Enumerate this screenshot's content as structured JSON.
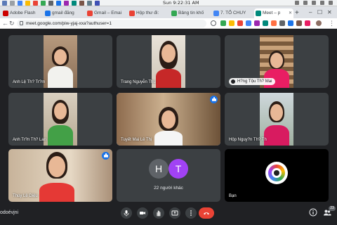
{
  "os": {
    "clock": "Sun 9:22:31 AM"
  },
  "browser": {
    "tabs": [
      {
        "label": "Adobe Flash",
        "color": "#cc0000"
      },
      {
        "label": "gmail đăng",
        "color": "#1a73e8"
      },
      {
        "label": "Gmail – Emai",
        "color": "#ea4335"
      },
      {
        "label": "Hộp thư đi:",
        "color": "#ea4335"
      },
      {
        "label": "Bảng tin khố",
        "color": "#34a853"
      },
      {
        "label": "7. TỔ CHUY",
        "color": "#4285f4"
      },
      {
        "label": "Meet – p",
        "color": "#00897b"
      }
    ],
    "url": "meet.google.com/piw-yjaj-xxa?authuser=1"
  },
  "meet": {
    "tiles": [
      {
        "name": "Anh Lệ Th? Tr?m"
      },
      {
        "name": "Trang Nguyễn Thu"
      },
      {
        "name": "H?ng Tộu Th? Mai"
      },
      {
        "name": "Anh Tr?n Th? Lan"
      },
      {
        "name": "Tuyết Mai Lê Thị"
      },
      {
        "name": "Hộp Nguy?n Th? Th"
      },
      {
        "name": "Thúy Lê Diệu"
      },
      {
        "name": "22 người khác",
        "avatars": [
          "H",
          "T"
        ]
      },
      {
        "name": "Bạn"
      }
    ],
    "meeting_code": "odoévjni",
    "participant_count": "23"
  },
  "colors": {
    "accent": "#8ab4f8",
    "end_call": "#ea4335",
    "avatar_h": "#5f6368",
    "avatar_t": "#a142f4"
  },
  "icons": [
    "mic-icon",
    "camera-icon",
    "raise-hand-icon",
    "present-icon",
    "more-icon",
    "end-call-icon",
    "info-icon",
    "people-icon"
  ]
}
